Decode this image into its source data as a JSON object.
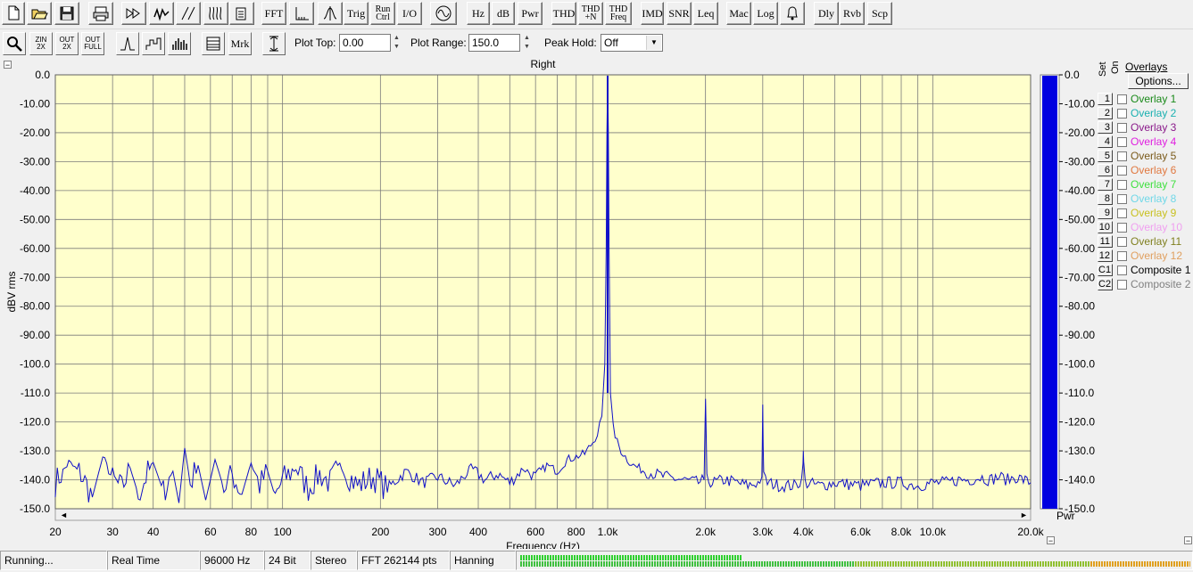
{
  "toolbar_row1": {
    "buttons": [
      {
        "name": "new-file-button",
        "label": "",
        "icon": "new-file-icon"
      },
      {
        "name": "open-file-button",
        "label": "",
        "icon": "open-folder-icon"
      },
      {
        "name": "save-file-button",
        "label": "",
        "icon": "floppy-disk-icon"
      },
      {
        "name": "print-button",
        "label": "",
        "icon": "printer-icon"
      },
      {
        "name": "fast-forward-button",
        "label": "",
        "icon": "fast-forward-icon"
      },
      {
        "name": "waveform-button",
        "label": "",
        "icon": "waveform-icon"
      },
      {
        "name": "ramp-button",
        "label": "",
        "icon": "ramp-icon"
      },
      {
        "name": "sweep-button",
        "label": "",
        "icon": "sweep-icon"
      },
      {
        "name": "notepad-button",
        "label": "",
        "icon": "notepad-icon"
      },
      {
        "name": "fft-button",
        "label": "FFT"
      },
      {
        "name": "axis-button",
        "label": "",
        "icon": "axis-icon"
      },
      {
        "name": "trigger-shape-button",
        "label": "",
        "icon": "trigger-shape-icon"
      },
      {
        "name": "trig-button",
        "label": "Trig"
      },
      {
        "name": "run-ctrl-button",
        "label": "Run\nCtrl"
      },
      {
        "name": "io-button",
        "label": "I/O"
      },
      {
        "name": "generator-button",
        "label": "",
        "icon": "sine-circle-icon"
      },
      {
        "name": "hz-button",
        "label": "Hz"
      },
      {
        "name": "db-button",
        "label": "dB"
      },
      {
        "name": "pwr-button",
        "label": "Pwr"
      },
      {
        "name": "thd-button",
        "label": "THD"
      },
      {
        "name": "thd-n-button",
        "label": "THD\n+N"
      },
      {
        "name": "thd-freq-button",
        "label": "THD\nFreq"
      },
      {
        "name": "imd-button",
        "label": "IMD"
      },
      {
        "name": "snr-button",
        "label": "SNR"
      },
      {
        "name": "leq-button",
        "label": "Leq"
      },
      {
        "name": "mac-button",
        "label": "Mac"
      },
      {
        "name": "log-button",
        "label": "Log"
      },
      {
        "name": "alarm-button",
        "label": "",
        "icon": "bell-icon"
      },
      {
        "name": "dly-button",
        "label": "Dly"
      },
      {
        "name": "rvb-button",
        "label": "Rvb"
      },
      {
        "name": "scp-button",
        "label": "Scp"
      }
    ]
  },
  "toolbar_row2": {
    "buttons": [
      {
        "name": "zoom-button",
        "label": "",
        "icon": "magnifier-icon"
      },
      {
        "name": "zoom-in-2x-button",
        "label": "ZIN\n2X"
      },
      {
        "name": "zoom-out-2x-button",
        "label": "OUT\n2X"
      },
      {
        "name": "zoom-out-full-button",
        "label": "OUT\nFULL"
      },
      {
        "name": "line-mode-button",
        "label": "",
        "icon": "peak-line-icon"
      },
      {
        "name": "step-mode-button",
        "label": "",
        "icon": "step-icon"
      },
      {
        "name": "bar-mode-button",
        "label": "",
        "icon": "bars-icon"
      },
      {
        "name": "table-button",
        "label": "",
        "icon": "table-icon"
      },
      {
        "name": "marker-button",
        "label": "Mrk"
      },
      {
        "name": "vertical-scale-button",
        "label": "",
        "icon": "vertical-arrows-icon"
      }
    ],
    "plot_top_label": "Plot Top:",
    "plot_top_value": "0.00",
    "plot_range_label": "Plot Range:",
    "plot_range_value": "150.0",
    "peak_hold_label": "Peak Hold:",
    "peak_hold_value": "Off"
  },
  "graph": {
    "colors": {
      "background": "#ffffcc",
      "grid": "#7a7a7a",
      "trace": "#1010c8",
      "bar": "#0000e0"
    },
    "bar_axis_label": "Pwr",
    "bar_level_dbv": -0.3
  },
  "chart_data": {
    "type": "line",
    "title": "Right",
    "xlabel": "Frequency (Hz)",
    "ylabel": "dBV rms",
    "xscale": "log",
    "xlim": [
      20,
      20000
    ],
    "ylim": [
      -150,
      0
    ],
    "grid": true,
    "y_ticks": [
      "0.0",
      "-10.00",
      "-20.00",
      "-30.00",
      "-40.00",
      "-50.00",
      "-60.00",
      "-70.00",
      "-80.00",
      "-90.00",
      "-100.0",
      "-110.0",
      "-120.0",
      "-130.0",
      "-140.0",
      "-150.0"
    ],
    "x_ticks": [
      {
        "v": 20,
        "label": "20"
      },
      {
        "v": 30,
        "label": "30"
      },
      {
        "v": 40,
        "label": "40"
      },
      {
        "v": 60,
        "label": "60"
      },
      {
        "v": 80,
        "label": "80"
      },
      {
        "v": 100,
        "label": "100"
      },
      {
        "v": 200,
        "label": "200"
      },
      {
        "v": 300,
        "label": "300"
      },
      {
        "v": 400,
        "label": "400"
      },
      {
        "v": 600,
        "label": "600"
      },
      {
        "v": 800,
        "label": "800"
      },
      {
        "v": 1000,
        "label": "1.0k"
      },
      {
        "v": 2000,
        "label": "2.0k"
      },
      {
        "v": 3000,
        "label": "3.0k"
      },
      {
        "v": 4000,
        "label": "4.0k"
      },
      {
        "v": 6000,
        "label": "6.0k"
      },
      {
        "v": 8000,
        "label": "8.0k"
      },
      {
        "v": 10000,
        "label": "10.0k"
      },
      {
        "v": 20000,
        "label": "20.0k"
      }
    ],
    "series": [
      {
        "x": [
          20,
          22,
          24,
          26,
          28,
          30,
          32,
          34,
          36,
          38,
          40,
          43,
          46,
          48,
          50,
          52,
          55,
          58,
          62,
          66,
          70,
          75,
          80,
          85,
          90,
          95,
          100,
          110,
          120,
          130,
          140,
          150,
          170,
          190,
          210,
          240,
          270,
          300,
          340,
          380,
          420,
          460,
          500,
          550,
          600,
          650,
          700,
          750,
          800,
          850,
          900,
          930,
          960,
          980,
          990,
          995,
          1000,
          1005,
          1010,
          1020,
          1040,
          1070,
          1100,
          1150,
          1200,
          1300,
          1400,
          1500,
          1700,
          1900,
          1980,
          1990,
          2000,
          2010,
          2020,
          2100,
          2300,
          2500,
          2700,
          2900,
          2980,
          2990,
          3000,
          3010,
          3020,
          3100,
          3400,
          3800,
          3950,
          3990,
          4000,
          4010,
          4050,
          4500,
          5000,
          6000,
          7000,
          8000,
          9000,
          10000,
          11000,
          12000,
          13000,
          14000,
          15000,
          16000,
          17000,
          18000,
          19000,
          20000
        ],
        "y": [
          -141,
          -134,
          -138,
          -146,
          -132,
          -140,
          -143,
          -136,
          -145,
          -139,
          -134,
          -144,
          -137,
          -148,
          -129,
          -141,
          -135,
          -147,
          -133,
          -143,
          -138,
          -145,
          -134,
          -142,
          -137,
          -146,
          -140,
          -136,
          -143,
          -138,
          -141,
          -135,
          -142,
          -139,
          -143,
          -137,
          -141,
          -139,
          -142,
          -136,
          -140,
          -138,
          -141,
          -136,
          -139,
          -135,
          -137,
          -133,
          -132,
          -131,
          -127,
          -124,
          -118,
          -100,
          -60,
          -20,
          -0.3,
          -20,
          -60,
          -110,
          -122,
          -127,
          -130,
          -133,
          -135,
          -137,
          -138,
          -139,
          -140,
          -141,
          -140,
          -125,
          -112,
          -125,
          -140,
          -141,
          -140,
          -141,
          -142,
          -141,
          -139,
          -128,
          -114,
          -128,
          -139,
          -141,
          -142,
          -142,
          -140,
          -133,
          -131,
          -134,
          -141,
          -142,
          -141,
          -142,
          -141,
          -141,
          -142,
          -141,
          -141,
          -140,
          -140,
          -139,
          -140,
          -139,
          -140,
          -139,
          -140,
          -141
        ]
      }
    ]
  },
  "overlays": {
    "title": "Overlays",
    "set_header": "Set",
    "on_header": "On",
    "options_button": "Options...",
    "items": [
      {
        "set": "1",
        "name": "Overlay 1",
        "color": "#1a8a1a"
      },
      {
        "set": "2",
        "name": "Overlay 2",
        "color": "#1ab0b0"
      },
      {
        "set": "3",
        "name": "Overlay 3",
        "color": "#8a1a8a"
      },
      {
        "set": "4",
        "name": "Overlay 4",
        "color": "#e020e0"
      },
      {
        "set": "5",
        "name": "Overlay 5",
        "color": "#7a5a1a"
      },
      {
        "set": "6",
        "name": "Overlay 6",
        "color": "#e07840"
      },
      {
        "set": "7",
        "name": "Overlay 7",
        "color": "#40e040"
      },
      {
        "set": "8",
        "name": "Overlay 8",
        "color": "#70d8e8"
      },
      {
        "set": "9",
        "name": "Overlay 9",
        "color": "#c8c020"
      },
      {
        "set": "10",
        "name": "Overlay 10",
        "color": "#f0a0f0"
      },
      {
        "set": "11",
        "name": "Overlay 11",
        "color": "#808020"
      },
      {
        "set": "12",
        "name": "Overlay 12",
        "color": "#e0a060"
      },
      {
        "set": "C1",
        "name": "Composite 1",
        "color": "#000000"
      },
      {
        "set": "C2",
        "name": "Composite 2",
        "color": "#808080"
      }
    ]
  },
  "statusbar": {
    "run_state": "Running...",
    "mode": "Real Time",
    "sample_rate": "96000 Hz",
    "bit_depth": "24 Bit",
    "channels": "Stereo",
    "fft_size": "FFT 262144 pts",
    "window": "Hanning",
    "buffer_level_fraction": 0.33
  }
}
